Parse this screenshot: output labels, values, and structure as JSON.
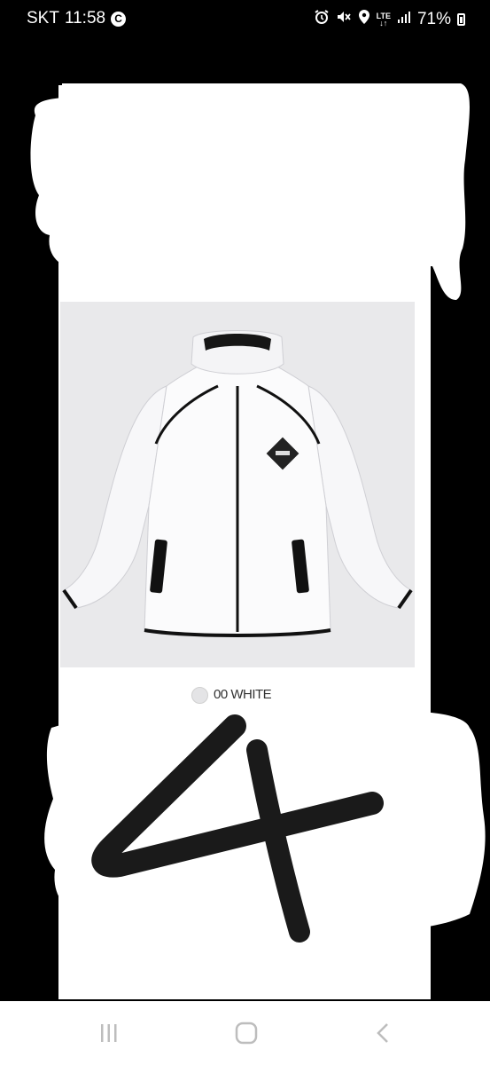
{
  "status_bar": {
    "carrier": "SKT",
    "time": "11:58",
    "app_badge": "C",
    "network": "LTE",
    "battery": "71%",
    "icons": [
      "alarm-icon",
      "mute-icon",
      "location-icon",
      "lte-icon",
      "signal-icon",
      "battery-icon"
    ]
  },
  "product": {
    "color_option": "00 WHITE"
  },
  "overlay": {
    "scribble_text": "4"
  },
  "nav_bar": {
    "icons": [
      "recent-apps-icon",
      "home-icon",
      "back-icon"
    ]
  },
  "colors": {
    "background": "#000000",
    "scribble": "#ffffff",
    "ink": "#111111",
    "nav_icon": "#bdbdbd"
  }
}
